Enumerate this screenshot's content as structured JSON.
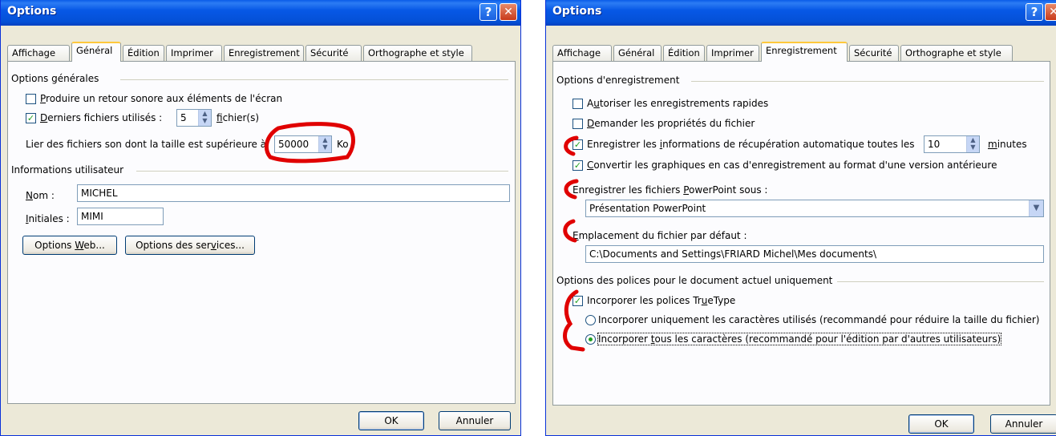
{
  "left_dialog": {
    "title": "Options",
    "tabs": [
      "Affichage",
      "Général",
      "Édition",
      "Imprimer",
      "Enregistrement",
      "Sécurité",
      "Orthographe et style"
    ],
    "active_tab": "Général",
    "options_generales": {
      "label": "Options générales",
      "retour_sonore": {
        "before": "",
        "accel": "P",
        "after": "roduire un retour sonore aux éléments de l'écran",
        "checked": false
      },
      "derniers_fichiers": {
        "before": "",
        "accel": "D",
        "after": "erniers fichiers utilisés :",
        "checked": true,
        "value": "5",
        "suffix_accel": "f",
        "suffix_after": "ichier(s)"
      },
      "lier_fichiers": {
        "label": "Lier des fichiers son dont la taille est supérieure à",
        "value": "50000",
        "unit": "Ko"
      }
    },
    "informations_utilisateur": {
      "label": "Informations utilisateur",
      "nom": {
        "accel": "N",
        "after": "om :",
        "value": "MICHEL"
      },
      "initiales": {
        "accel": "I",
        "after": "nitiales :",
        "value": "MIMI"
      }
    },
    "buttons": {
      "options_web": {
        "before": "Options ",
        "accel": "W",
        "after": "eb..."
      },
      "options_services": {
        "before": "Options des ser",
        "accel": "v",
        "after": "ices..."
      },
      "ok": "OK",
      "annuler": "Annuler"
    }
  },
  "right_dialog": {
    "title": "Options",
    "tabs": [
      "Affichage",
      "Général",
      "Édition",
      "Imprimer",
      "Enregistrement",
      "Sécurité",
      "Orthographe et style"
    ],
    "active_tab": "Enregistrement",
    "options_enregistrement": {
      "label": "Options d'enregistrement",
      "rapides": {
        "before": "A",
        "accel": "u",
        "after": "toriser les enregistrements rapides",
        "checked": false
      },
      "proprietes": {
        "before": "",
        "accel": "D",
        "after": "emander les propriétés du fichier",
        "checked": false
      },
      "recuperation": {
        "before": "Enregistrer les ",
        "accel": "i",
        "after": "nformations de récupération automatique toutes les",
        "checked": true,
        "value": "10",
        "unit_accel": "m",
        "unit_after": "inutes"
      },
      "convertir": {
        "before": "",
        "accel": "C",
        "after": "onvertir les graphiques en cas d'enregistrement au format d'une version antérieure",
        "checked": true
      }
    },
    "format": {
      "before": "Enregistrer les fichiers ",
      "accel": "P",
      "after": "owerPoint sous :",
      "value": "Présentation PowerPoint"
    },
    "emplacement": {
      "before": "",
      "accel": "E",
      "after": "mplacement du fichier par défaut :",
      "value": "C:\\Documents and Settings\\FRIARD Michel\\Mes documents\\"
    },
    "polices": {
      "label": "Options des polices pour le document actuel uniquement",
      "incorporer": {
        "before": "Incorporer les polices Tr",
        "accel": "u",
        "after": "eType",
        "checked": true
      },
      "uniquement": {
        "text": "Incorporer uniquement les caractères utilisés  (recommandé pour réduire la taille du fichier)",
        "selected": false
      },
      "tous": {
        "before": "Incorporer ",
        "accel": "t",
        "after": "ous les caractères (recommandé pour l'édition par d'autres utilisateurs)",
        "selected": true
      }
    },
    "buttons": {
      "ok": "OK",
      "annuler": "Annuler"
    }
  },
  "colors": {
    "titlebar": "#0450d6",
    "dialog_bg": "#ece9d8",
    "panel_bg": "#fcfcfe",
    "active_tab_accent": "#ffc83c",
    "check": "#21a121",
    "annotation": "#e00000"
  },
  "icons": {
    "help": "help-icon",
    "close": "close-icon",
    "spin": "spinner-arrows-icon",
    "dropdown": "chevron-down-icon"
  }
}
